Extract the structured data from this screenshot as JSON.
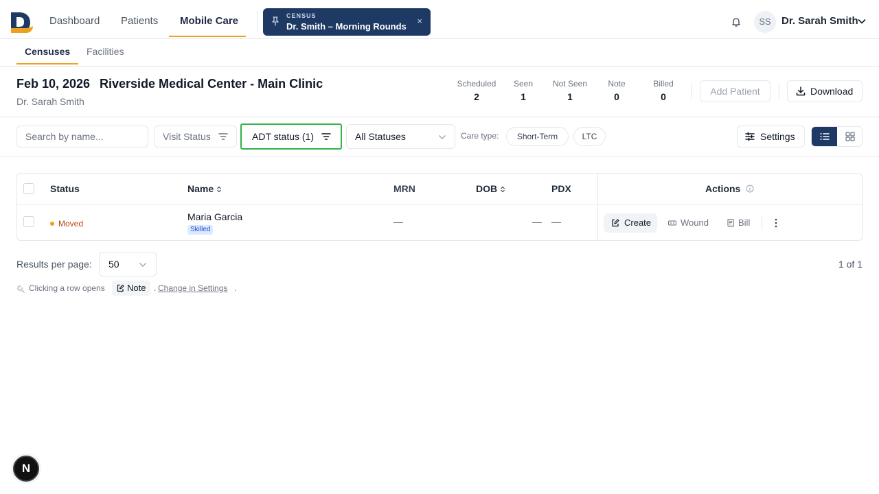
{
  "app": {
    "logo_icon": "d-logo-icon",
    "colors": {
      "navy": "#1e3a64",
      "accent": "#f0a020",
      "highlight": "#2fb344",
      "moved": "#c2410c"
    }
  },
  "nav": {
    "items": [
      {
        "label": "Dashboard"
      },
      {
        "label": "Patients"
      },
      {
        "label": "Mobile Care"
      }
    ],
    "active": "Mobile Care"
  },
  "census_pill": {
    "caption": "CENSUS",
    "title": "Dr. Smith – Morning Rounds",
    "close": "×"
  },
  "user": {
    "initials": "SS",
    "name": "Dr. Sarah Smith"
  },
  "subtabs": [
    {
      "label": "Censuses"
    },
    {
      "label": "Facilities"
    }
  ],
  "header": {
    "date": "Feb 10, 2026",
    "facility": "Riverside Medical Center - Main Clinic",
    "provider": "Dr. Sarah Smith",
    "stats": [
      {
        "label": "Scheduled",
        "value": "2"
      },
      {
        "label": "Seen",
        "value": "1"
      },
      {
        "label": "Not Seen",
        "value": "1"
      },
      {
        "label": "Note",
        "value": "0"
      },
      {
        "label": "Billed",
        "value": "0"
      }
    ],
    "add_patient_label": "Add Patient",
    "download_label": "Download"
  },
  "filters": {
    "search_placeholder": "Search by name...",
    "visit_status_label": "Visit Status",
    "adt_status_label": "ADT status (1)",
    "status_select_value": "All Statuses",
    "care_type_label": "Care type:",
    "care_types": [
      "Short-Term",
      "LTC"
    ],
    "settings_label": "Settings"
  },
  "table": {
    "columns": {
      "status": "Status",
      "name": "Name",
      "mrn": "MRN",
      "dob": "DOB",
      "pdx": "PDX",
      "actions": "Actions"
    },
    "rows": [
      {
        "status": "Moved",
        "name": "Maria Garcia",
        "badge": "Skilled",
        "mrn": "—",
        "dob": "—",
        "pdx": "—",
        "actions": {
          "create": "Create",
          "wound": "Wound",
          "bill": "Bill"
        }
      }
    ]
  },
  "pagination": {
    "results_label": "Results per page:",
    "per_page": "50",
    "page_info": "1 of 1"
  },
  "hint": {
    "prefix": "Clicking a row opens",
    "target": "Note",
    "sep": ".",
    "link": "Change in Settings",
    "suffix": "."
  },
  "dev_badge": "N"
}
